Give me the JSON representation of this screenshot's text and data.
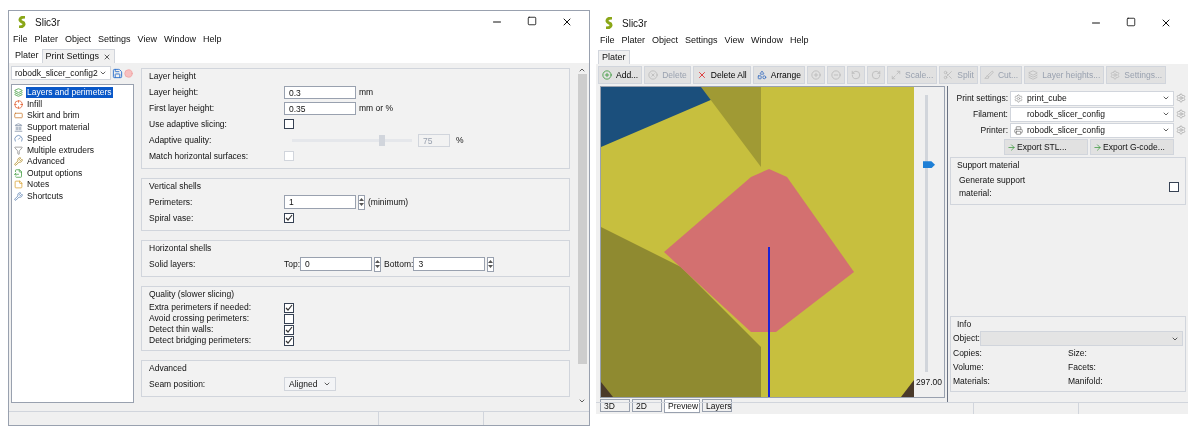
{
  "left_window": {
    "title": "Slic3r",
    "menu": [
      "File",
      "Plater",
      "Object",
      "Settings",
      "View",
      "Window",
      "Help"
    ],
    "tabs": [
      {
        "label": "Plater",
        "selected": false,
        "closable": false
      },
      {
        "label": "Print Settings",
        "selected": true,
        "closable": true
      }
    ],
    "preset": "robodk_slicer_config2",
    "sidebar": {
      "items": [
        {
          "label": "Layers and perimeters",
          "selected": true
        },
        {
          "label": "Infill",
          "selected": false
        },
        {
          "label": "Skirt and brim",
          "selected": false
        },
        {
          "label": "Support material",
          "selected": false
        },
        {
          "label": "Speed",
          "selected": false
        },
        {
          "label": "Multiple extruders",
          "selected": false
        },
        {
          "label": "Advanced",
          "selected": false
        },
        {
          "label": "Output options",
          "selected": false
        },
        {
          "label": "Notes",
          "selected": false
        },
        {
          "label": "Shortcuts",
          "selected": false
        }
      ]
    },
    "sections": [
      {
        "title": "Layer height",
        "rows": [
          {
            "kind": "text",
            "label": "Layer height:",
            "value": "0.3",
            "unit": "mm"
          },
          {
            "kind": "text",
            "label": "First layer height:",
            "value": "0.35",
            "unit": "mm or %"
          },
          {
            "kind": "checkbox",
            "label": "Use adaptive slicing:",
            "checked": false,
            "disabled": false
          },
          {
            "kind": "slider",
            "label": "Adaptive quality:",
            "level": 0.75,
            "value": "75",
            "unit": "%",
            "disabled": true
          },
          {
            "kind": "checkbox",
            "label": "Match horizontal surfaces:",
            "checked": false,
            "disabled": true
          }
        ]
      },
      {
        "title": "Vertical shells",
        "rows": [
          {
            "kind": "spin",
            "label": "Perimeters:",
            "value": "1",
            "unit": "(minimum)"
          },
          {
            "kind": "checkbox",
            "label": "Spiral vase:",
            "checked": true,
            "disabled": false
          }
        ]
      },
      {
        "title": "Horizontal shells",
        "rows": [
          {
            "kind": "spin_pair",
            "label": "Solid layers:",
            "fields": [
              {
                "label": "Top:",
                "value": "0"
              },
              {
                "label": "Bottom:",
                "value": "3"
              }
            ]
          }
        ]
      },
      {
        "title": "Quality (slower slicing)",
        "rows": [
          {
            "kind": "checkbox",
            "label": "Extra perimeters if needed:",
            "checked": true,
            "disabled": false
          },
          {
            "kind": "checkbox",
            "label": "Avoid crossing perimeters:",
            "checked": false,
            "disabled": false
          },
          {
            "kind": "checkbox",
            "label": "Detect thin walls:",
            "checked": true,
            "disabled": false
          },
          {
            "kind": "checkbox",
            "label": "Detect bridging perimeters:",
            "checked": true,
            "disabled": false
          }
        ]
      },
      {
        "title": "Advanced",
        "rows": [
          {
            "kind": "select",
            "label": "Seam position:",
            "value": "Aligned"
          }
        ]
      }
    ]
  },
  "right_window": {
    "title": "Slic3r",
    "menu": [
      "File",
      "Plater",
      "Object",
      "Settings",
      "View",
      "Window",
      "Help"
    ],
    "tabs": [
      {
        "label": "Plater",
        "selected": true
      }
    ],
    "toolbar": [
      {
        "label": "Add...",
        "disabled": false
      },
      {
        "label": "Delete",
        "disabled": true
      },
      {
        "label": "Delete All",
        "disabled": false
      },
      {
        "label": "Arrange",
        "disabled": false
      },
      {
        "disabled": true
      },
      {
        "disabled": true
      },
      {
        "disabled": true
      },
      {
        "disabled": true
      },
      {
        "label": "Scale...",
        "disabled": true
      },
      {
        "label": "Split",
        "disabled": true
      },
      {
        "label": "Cut...",
        "disabled": true
      },
      {
        "label": "Layer heights...",
        "disabled": true
      },
      {
        "label": "Settings...",
        "disabled": true
      }
    ],
    "layer_slider": {
      "level": 0.75,
      "reading": "297.00"
    },
    "view_tabs": [
      {
        "label": "3D",
        "selected": false
      },
      {
        "label": "2D",
        "selected": false
      },
      {
        "label": "Preview",
        "selected": true
      },
      {
        "label": "Layers",
        "selected": false
      }
    ],
    "presets": [
      {
        "label": "Print settings:",
        "value": "print_cube"
      },
      {
        "label": "Filament:",
        "value": "robodk_slicer_config"
      },
      {
        "label": "Printer:",
        "value": "robodk_slicer_config"
      }
    ],
    "export_buttons": [
      "Export STL...",
      "Export G-code..."
    ],
    "support": {
      "title": "Support material",
      "label": "Generate support material:",
      "checked": false
    },
    "info": {
      "title": "Info",
      "object_label": "Object:",
      "fields": [
        [
          "Copies:",
          "Size:"
        ],
        [
          "Volume:",
          "Facets:"
        ],
        [
          "Materials:",
          "Manifold:"
        ]
      ]
    }
  }
}
